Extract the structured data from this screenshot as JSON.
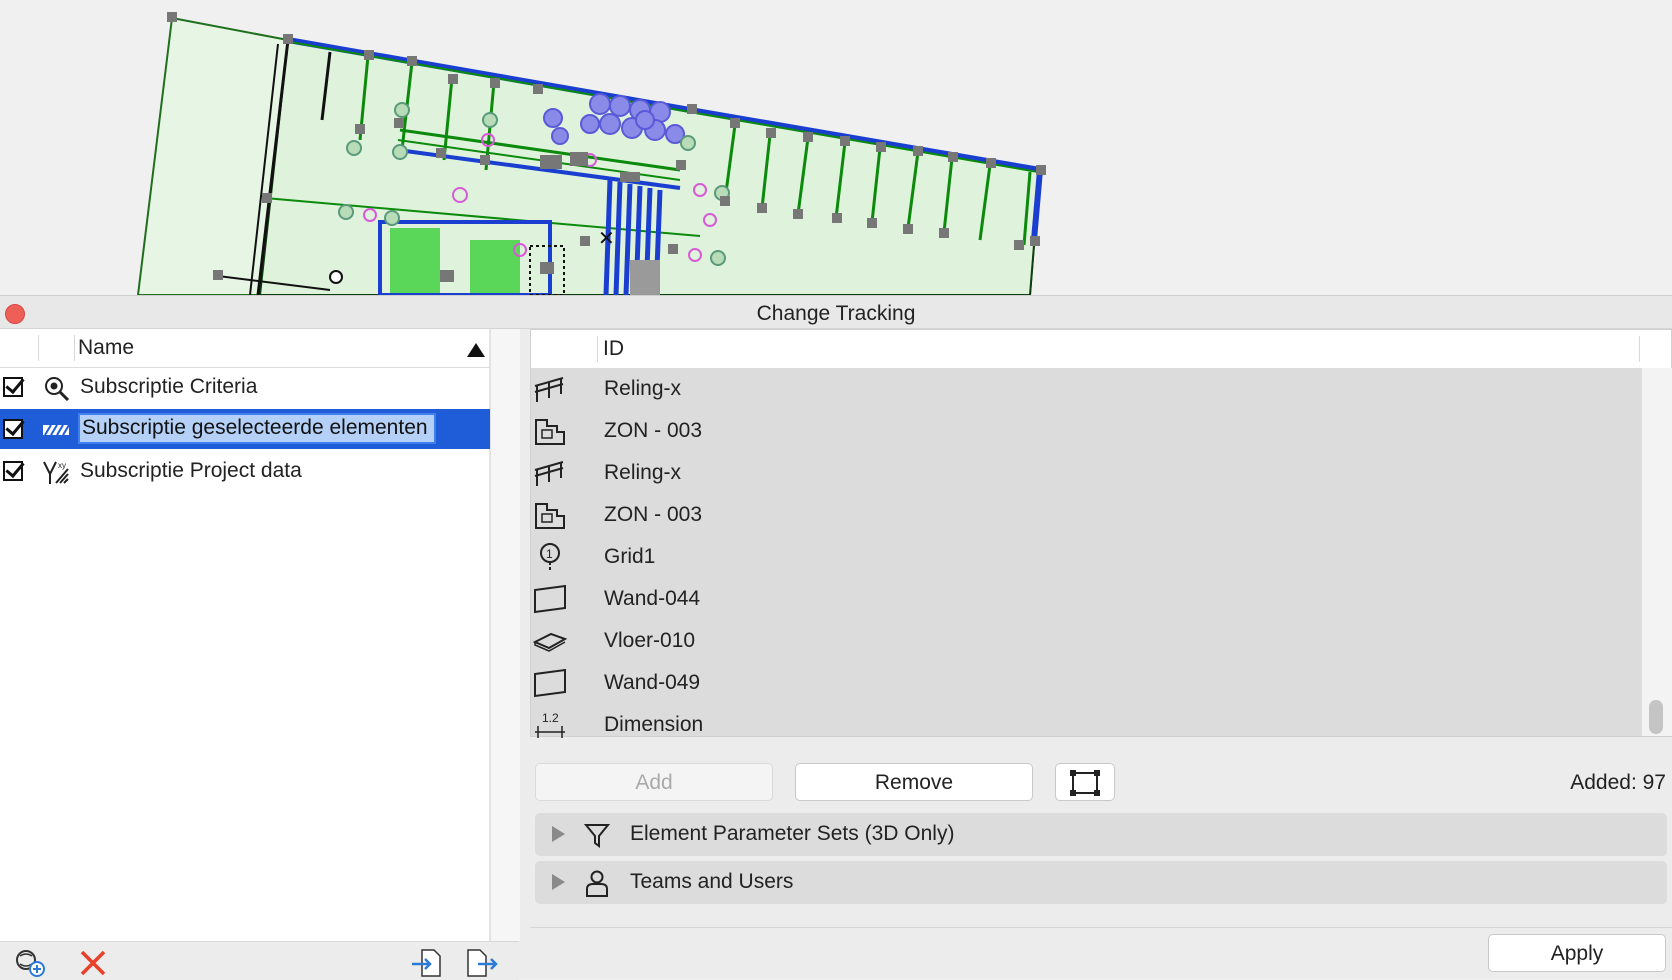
{
  "window": {
    "title": "Change Tracking"
  },
  "left_pane": {
    "column_header": "Name",
    "items": [
      {
        "label": "Subscriptie Criteria",
        "checked": true,
        "icon": "criteria-search-icon",
        "selected": false
      },
      {
        "label": "Subscriptie geselecteerde elementen",
        "checked": true,
        "icon": "hatch-selection-icon",
        "selected": true
      },
      {
        "label": "Subscriptie Project data",
        "checked": true,
        "icon": "project-data-icon",
        "selected": false
      }
    ],
    "footer_icons": [
      "add-subscription-icon",
      "delete-icon",
      "import-icon",
      "export-icon"
    ]
  },
  "right_pane": {
    "column_header": "ID",
    "items": [
      {
        "label": "Reling-x",
        "icon": "railing-icon"
      },
      {
        "label": "ZON - 003",
        "icon": "zone-icon"
      },
      {
        "label": "Reling-x",
        "icon": "railing-icon"
      },
      {
        "label": "ZON - 003",
        "icon": "zone-icon"
      },
      {
        "label": "Grid1",
        "icon": "grid-icon"
      },
      {
        "label": "Wand-044",
        "icon": "wall-icon"
      },
      {
        "label": "Vloer-010",
        "icon": "slab-icon"
      },
      {
        "label": "Wand-049",
        "icon": "wall-icon"
      },
      {
        "label": "Dimension",
        "icon": "dimension-icon"
      }
    ],
    "dimension_icon_text": "1.2",
    "buttons": {
      "add_label": "Add",
      "remove_label": "Remove",
      "select_icon": "marquee-select-icon"
    },
    "added_count": "Added: 97",
    "sections": [
      {
        "label": "Element Parameter Sets (3D Only)",
        "icon": "filter-icon"
      },
      {
        "label": "Teams and Users",
        "icon": "user-icon"
      }
    ],
    "apply_label": "Apply"
  },
  "colors": {
    "selection": "#1e5cd8",
    "close_button": "#ee5f57",
    "delete": "#e8402a",
    "import_export": "#2a7bd6"
  }
}
